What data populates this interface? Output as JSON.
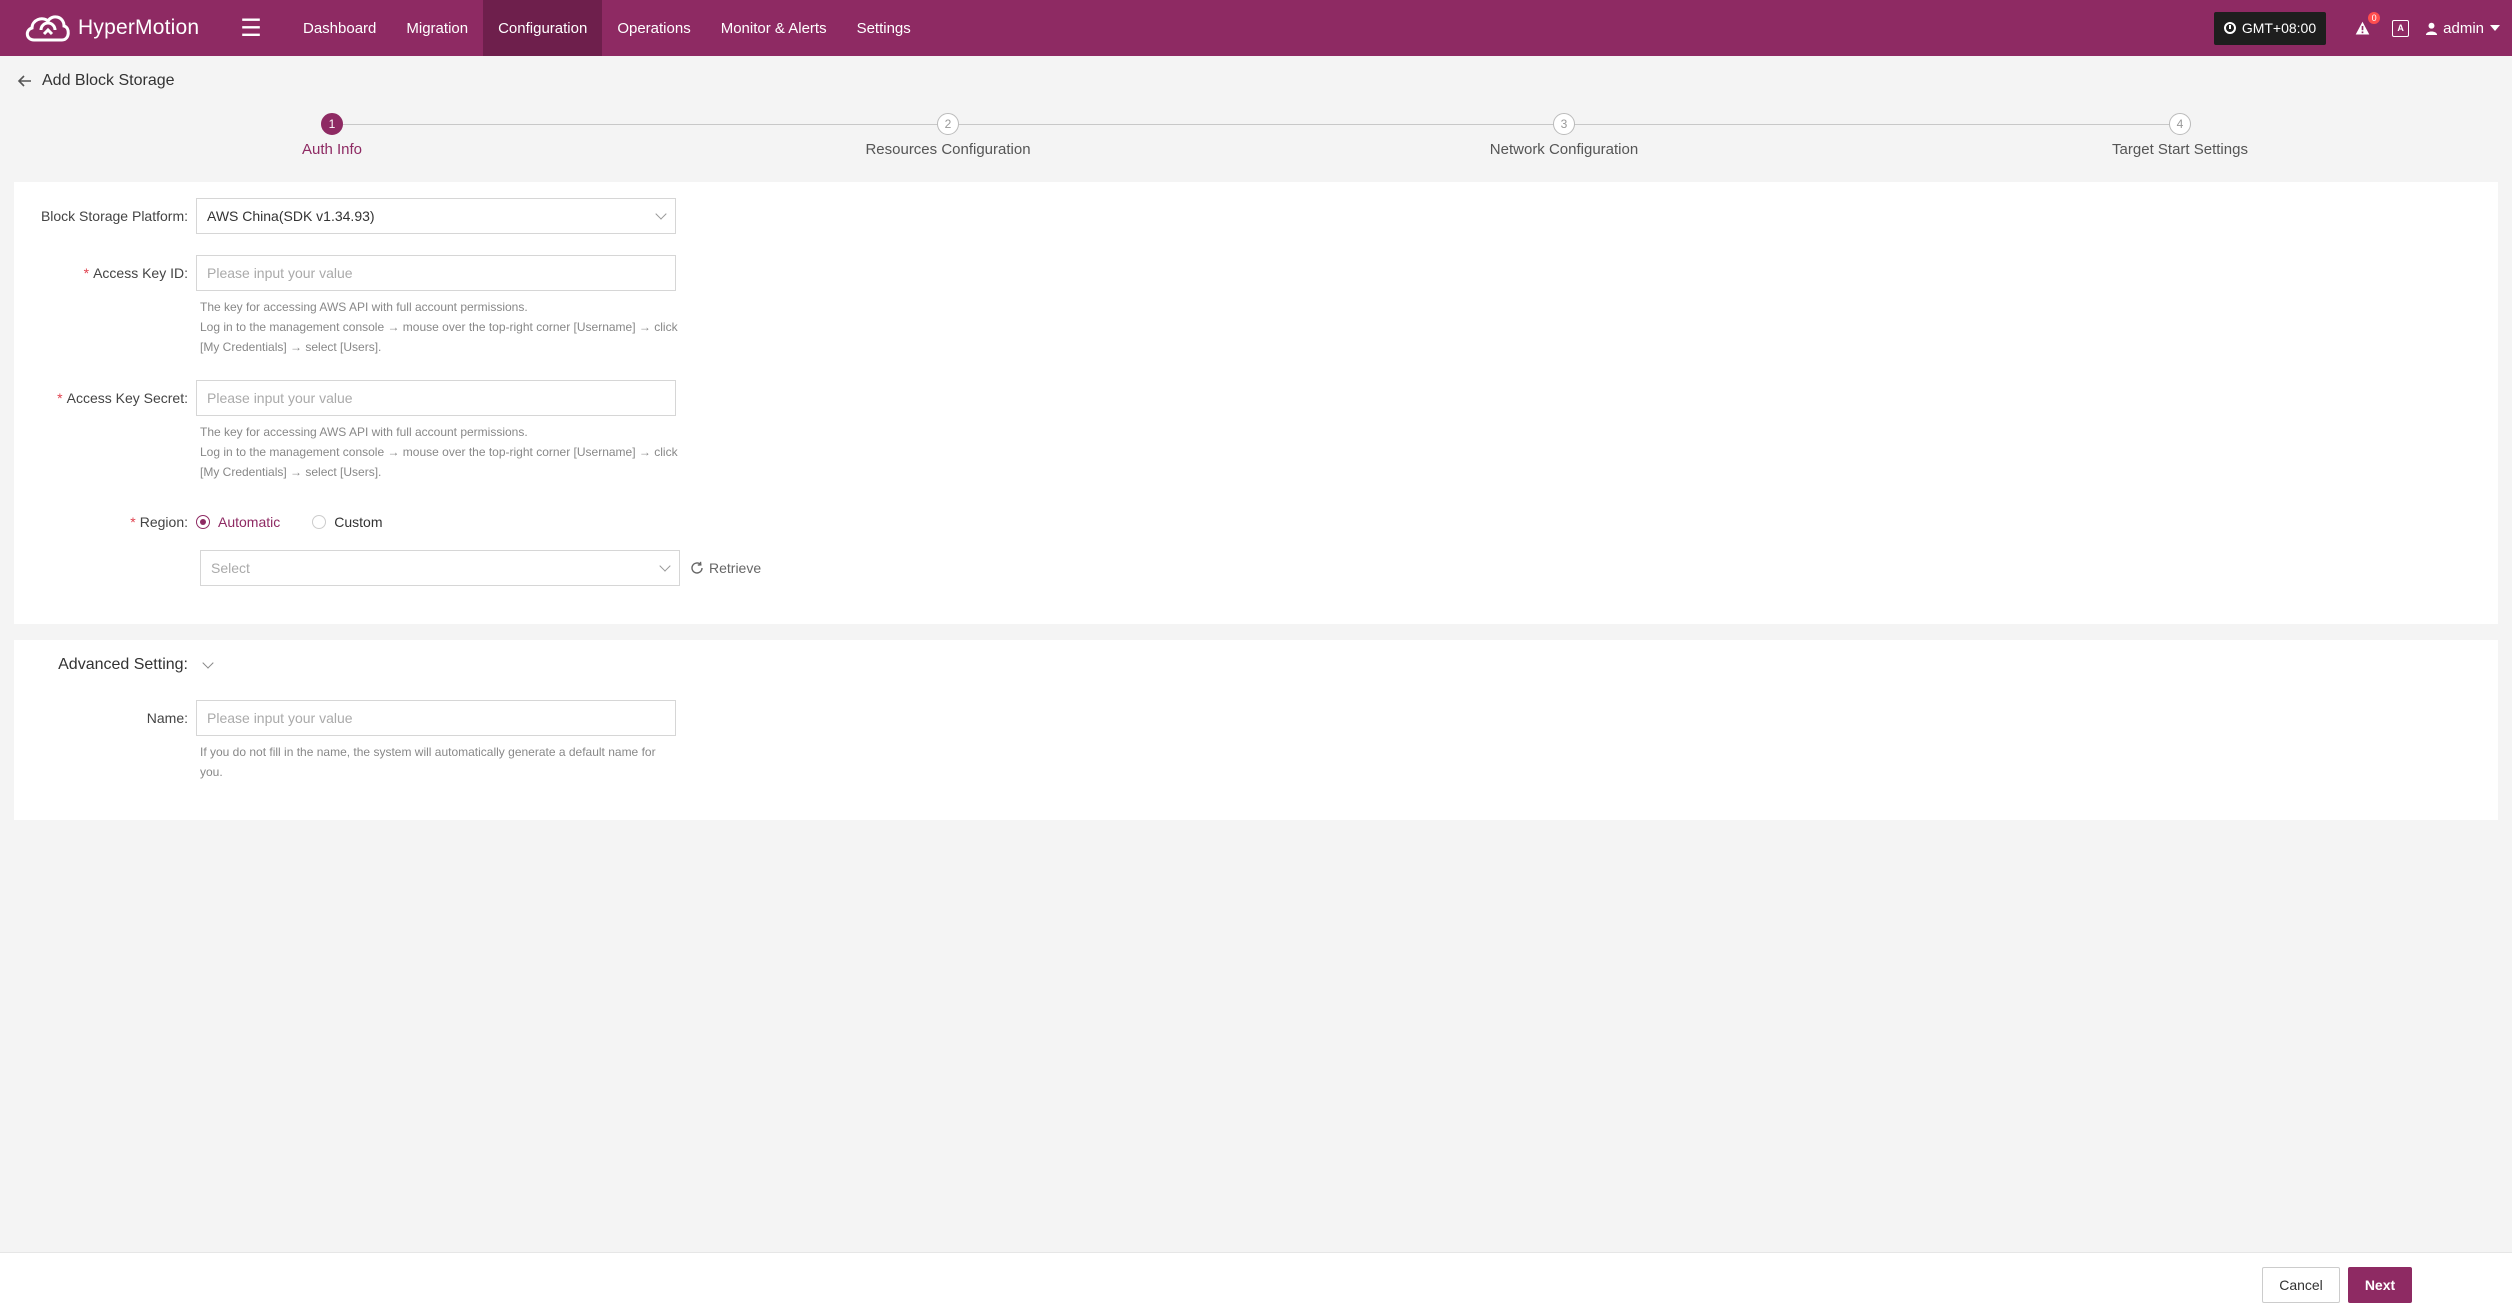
{
  "app": {
    "name": "HyperMotion",
    "nav": [
      {
        "label": "Dashboard",
        "active": false
      },
      {
        "label": "Migration",
        "active": false
      },
      {
        "label": "Configuration",
        "active": true
      },
      {
        "label": "Operations",
        "active": false
      },
      {
        "label": "Monitor & Alerts",
        "active": false
      },
      {
        "label": "Settings",
        "active": false
      }
    ],
    "timezone": "GMT+08:00",
    "notification_count": "0",
    "language_icon": "A",
    "user": "admin"
  },
  "page": {
    "title": "Add Block Storage"
  },
  "steps": [
    {
      "number": "1",
      "label": "Auth Info",
      "active": true
    },
    {
      "number": "2",
      "label": "Resources Configuration",
      "active": false
    },
    {
      "number": "3",
      "label": "Network Configuration",
      "active": false
    },
    {
      "number": "4",
      "label": "Target Start Settings",
      "active": false
    }
  ],
  "form": {
    "platform": {
      "label": "Block Storage Platform:",
      "value": "AWS China(SDK v1.34.93)"
    },
    "access_key_id": {
      "required": "*",
      "label": "Access Key ID:",
      "placeholder": "Please input your value",
      "help": [
        "The key for accessing AWS API with full account permissions.",
        "Log in to the management console → mouse over the top-right corner [Username] → click",
        "[My Credentials] → select [Users]."
      ]
    },
    "access_key_secret": {
      "required": "*",
      "label": "Access Key Secret:",
      "placeholder": "Please input your value",
      "help": [
        "The key for accessing AWS API with full account permissions.",
        "Log in to the management console → mouse over the top-right corner [Username] → click",
        "[My Credentials] → select [Users]."
      ]
    },
    "region": {
      "required": "*",
      "label": "Region:",
      "options": [
        "Automatic",
        "Custom"
      ],
      "selected": "Automatic",
      "select_placeholder": "Select",
      "retrieve_label": "Retrieve"
    }
  },
  "advanced": {
    "label": "Advanced Setting:",
    "name": {
      "label": "Name:",
      "placeholder": "Please input your value",
      "help": [
        "If you do not fill in the name, the system will automatically generate a default name for",
        "you."
      ]
    }
  },
  "footer": {
    "cancel_label": "Cancel",
    "next_label": "Next"
  },
  "colors": {
    "brand": "#8e2a63",
    "brand_dark": "#6e1f4c",
    "required": "#e0424f"
  }
}
